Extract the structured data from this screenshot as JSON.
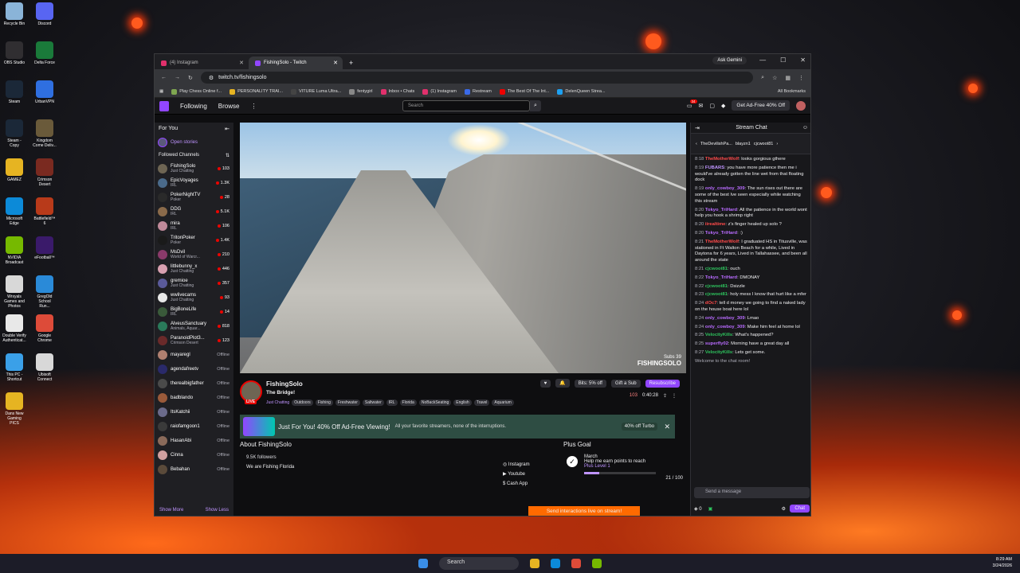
{
  "desktop": {
    "icons": [
      {
        "label": "Recycle Bin",
        "color": "#8ab4d8"
      },
      {
        "label": "Discord",
        "color": "#5865f2"
      },
      {
        "label": "OBS Studio",
        "color": "#302e31"
      },
      {
        "label": "Delta Force",
        "color": "#1a7a3a"
      },
      {
        "label": "Steam",
        "color": "#1b2838"
      },
      {
        "label": "UrbanVPN",
        "color": "#2f6fe0"
      },
      {
        "label": "Steam - Copy",
        "color": "#1b2838"
      },
      {
        "label": "Kingdom Come Deliv...",
        "color": "#6a5a3a"
      },
      {
        "label": "GAMEZ",
        "color": "#e6b422"
      },
      {
        "label": "Crimson Desert",
        "color": "#7a2a20"
      },
      {
        "label": "Microsoft Edge",
        "color": "#0c8ad8"
      },
      {
        "label": "Battlefield™ 6",
        "color": "#b83a1a"
      },
      {
        "label": "NVIDIA Broadcast",
        "color": "#76b900"
      },
      {
        "label": "eFootball™",
        "color": "#3a1a6a"
      },
      {
        "label": "Wrxyals Games and Photos",
        "color": "#d8d8d8"
      },
      {
        "label": "GregOld School Run...",
        "color": "#2a8ad8"
      },
      {
        "label": "Double Verify Authenticat...",
        "color": "#e8e8e8"
      },
      {
        "label": "Google Chrome",
        "color": "#dd4b39"
      },
      {
        "label": "This PC - Shortcut",
        "color": "#3aa0e8"
      },
      {
        "label": "Ubisoft Connect",
        "color": "#d8d8d8"
      },
      {
        "label": "Dans New Gaming PICS",
        "color": "#e6b422"
      }
    ]
  },
  "browser": {
    "tabs": [
      {
        "title": "(4) Instagram",
        "color": "#e1306c"
      },
      {
        "title": "FishingSolo - Twitch",
        "color": "#9146ff"
      }
    ],
    "ask": "Ask Gemini",
    "url": "twitch.tv/fishingsolo",
    "bookmarks": [
      "Play Chess Online f...",
      "PERSONALITY TRAI...",
      "VITURE Luma Ultra...",
      "fentygirl",
      "Inbox • Chats",
      "(1) Instagram",
      "Restream",
      "The Best Of The Int...",
      "DelenQueen Strea..."
    ],
    "all_bookmarks": "All Bookmarks"
  },
  "twitch": {
    "nav": [
      "Following",
      "Browse"
    ],
    "search_placeholder": "Search",
    "adfree": "Get Ad-Free 40% Off",
    "notif": "34",
    "sidebar": {
      "for_you": "For You",
      "open_stories": "Open stories",
      "followed": "Followed Channels",
      "show_more": "Show More",
      "show_less": "Show Less",
      "channels": [
        {
          "name": "FishingSolo",
          "game": "Just Chatting",
          "count": "103",
          "color": "#6e6553"
        },
        {
          "name": "EpicVoyages",
          "game": "IRL",
          "count": "1.3K",
          "color": "#4a6a8a"
        },
        {
          "name": "PokerNightTV",
          "game": "Poker",
          "count": "28",
          "color": "#2a2a2a"
        },
        {
          "name": "DDG",
          "game": "IRL",
          "count": "5.1K",
          "color": "#8a6a4a"
        },
        {
          "name": "mira",
          "game": "IRL",
          "count": "106",
          "color": "#c08a9a"
        },
        {
          "name": "TritonPoker",
          "game": "Poker",
          "count": "1.4K",
          "color": "#1a1a1a"
        },
        {
          "name": "MsDvil",
          "game": "World of Warcr...",
          "count": "210",
          "color": "#8a3a6a"
        },
        {
          "name": "littlebunny_x",
          "game": "Just Chatting",
          "count": "446",
          "color": "#d8a0b0"
        },
        {
          "name": "gremioe",
          "game": "Just Chatting",
          "count": "357",
          "color": "#5a5a9a"
        },
        {
          "name": "wwlivecams",
          "game": "Just Chatting",
          "count": "93",
          "color": "#e8e8e8"
        },
        {
          "name": "BigBoneLife",
          "game": "IRL",
          "count": "14",
          "color": "#3a5a3a"
        },
        {
          "name": "AlveusSanctuary",
          "game": "Animals, Aquar...",
          "count": "818",
          "color": "#2a7a5a"
        },
        {
          "name": "ParanoidPlot3...",
          "game": "Crimson Desert",
          "count": "123",
          "color": "#6a2a2a"
        },
        {
          "name": "mayaregl",
          "game": "",
          "count": "Offline",
          "color": "#b08070"
        },
        {
          "name": "agendafreetv",
          "game": "",
          "count": "Offline",
          "color": "#2a2a6a"
        },
        {
          "name": "therealbigfather",
          "game": "",
          "count": "Offline",
          "color": "#4a4a4a"
        },
        {
          "name": "badblando",
          "game": "",
          "count": "Offline",
          "color": "#9a5a3a"
        },
        {
          "name": "ItsKatchii",
          "game": "",
          "count": "Offline",
          "color": "#6a6a8a"
        },
        {
          "name": "raiofamgoon1",
          "game": "",
          "count": "Offline",
          "color": "#3a3a3a"
        },
        {
          "name": "HasanAbi",
          "game": "",
          "count": "Offline",
          "color": "#8a6a5a"
        },
        {
          "name": "Cinna",
          "game": "",
          "count": "Offline",
          "color": "#d0a0a0"
        },
        {
          "name": "Bebahan",
          "game": "",
          "count": "Offline",
          "color": "#5a4a3a"
        }
      ]
    },
    "video": {
      "subs": "Subs 39",
      "watermark": "FISHINGSOLO"
    },
    "stream": {
      "live": "LIVE",
      "name": "FishingSolo",
      "title": "The Bridge!",
      "category": "Just Chatting",
      "tags": [
        "Outdoors",
        "Fishing",
        "Freshwater",
        "Saltwater",
        "IRL",
        "Florida",
        "NoBackSeating",
        "English",
        "Travel",
        "Aquarium"
      ],
      "bits": "Bits: 5% off",
      "gift": "Gift a Sub",
      "resub": "Resubscribe",
      "viewers": "103",
      "uptime": "0:40:28"
    },
    "promo": {
      "title": "Just For You! 40% Off Ad-Free Viewing!",
      "sub": "All your favorite streamers, none of the interruptions.",
      "turbo": "40% off Turbo"
    },
    "about": {
      "title": "About FishingSolo",
      "followers": "9.5K followers",
      "desc": "We are Fishing Florida",
      "links": [
        "Instagram",
        "Youtube",
        "Cash App"
      ]
    },
    "goal": {
      "title": "Plus Goal",
      "month": "March",
      "text": "Help me earn points to reach",
      "plus": "Plus Level 1",
      "progress": "21 / 100",
      "fraction": 0.21
    },
    "send_interactions": "Send interactions live on stream!"
  },
  "chat": {
    "title": "Stream Chat",
    "gifters": [
      "TheDevilishPa...",
      "blayzn1",
      "cjcwoot81"
    ],
    "messages": [
      {
        "t": "8:18",
        "user": "TheMotherWolf",
        "color": "#ff4a4a",
        "text": "looks gorgious gthere"
      },
      {
        "t": "8:19",
        "user": "FUBARS",
        "color": "#bf94ff",
        "text": "you have more patience then me i would've already gotten the line wet from that floating dock"
      },
      {
        "t": "8:19",
        "user": "only_cowboy_309",
        "color": "#b96bff",
        "text": "The sun rises out there are some of the best Ive seen especially while watching this stream"
      },
      {
        "t": "8:20",
        "user": "Tokyo_TriHard",
        "color": "#b96bff",
        "text": "All the patience in the world wont help you hook a shrimp right"
      },
      {
        "t": "8:20",
        "user": "iirealtime",
        "color": "#ff4a4a",
        "text": "z's finger healed up solo ?"
      },
      {
        "t": "8:20",
        "user": "Tokyo_TriHard",
        "color": "#b96bff",
        "text": ":)"
      },
      {
        "t": "8:21",
        "user": "TheMotherWolf",
        "color": "#ff4a4a",
        "text": "I graduated HS in Titusville, was stationed in Ft Walton Beach for a while, Lived in Daytona for 6 years, Lived in Tallahassee, and been all around the state"
      },
      {
        "t": "8:21",
        "user": "cjcwoot81",
        "color": "#2ec45e",
        "text": "ouch"
      },
      {
        "t": "8:22",
        "user": "Tokyo_TriHard",
        "color": "#b96bff",
        "text": "DMONAY"
      },
      {
        "t": "8:22",
        "user": "cjcwoot81",
        "color": "#2ec45e",
        "text": "Dsizzle"
      },
      {
        "t": "8:23",
        "user": "cjcwoot81",
        "color": "#2ec45e",
        "text": "holy mess I know that hurt like a mfer"
      },
      {
        "t": "8:24",
        "user": "dOc7",
        "color": "#ff4a4a",
        "text": "tell d money we going to find a naked lady on the house boat here lol"
      },
      {
        "t": "8:24",
        "user": "only_cowboy_309",
        "color": "#b96bff",
        "text": "Lmao"
      },
      {
        "t": "8:24",
        "user": "only_cowboy_309",
        "color": "#b96bff",
        "text": "Make him feel at home lol"
      },
      {
        "t": "8:25",
        "user": "VelocityKills",
        "color": "#2ec45e",
        "text": "What's happened?"
      },
      {
        "t": "8:25",
        "user": "superfly02",
        "color": "#b96bff",
        "text": "Morning have a great day all"
      },
      {
        "t": "8:27",
        "user": "VelocityKills",
        "color": "#2ec45e",
        "text": "Lets get some."
      }
    ],
    "welcome": "Welcome to the chat room!",
    "placeholder": "Send a message",
    "points": "0",
    "chat_btn": "Chat"
  },
  "taskbar": {
    "search": "Search",
    "time": "8:29 AM",
    "date": "3/24/2026"
  }
}
